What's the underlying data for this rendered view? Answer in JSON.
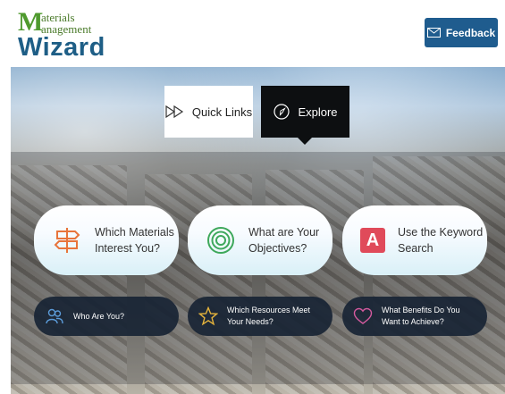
{
  "logo": {
    "m": "M",
    "line1": "aterials",
    "line2": "anagement",
    "wizard": "Wizard"
  },
  "feedback_label": "Feedback",
  "toggles": {
    "quick_links": "Quick Links",
    "explore": "Explore"
  },
  "cards": [
    {
      "label": "Which Materials\nInterest You?",
      "icon": "signpost-icon"
    },
    {
      "label": "What are Your\nObjectives?",
      "icon": "target-icon"
    },
    {
      "label": "Use the Keyword\nSearch",
      "icon": "letter-a-icon",
      "icon_text": "A"
    }
  ],
  "options": [
    {
      "label": "Who Are You?",
      "icon": "people-icon"
    },
    {
      "label": "Which Resources Meet\nYour Needs?",
      "icon": "star-icon"
    },
    {
      "label": "What Benefits Do You\nWant to Achieve?",
      "icon": "heart-icon"
    }
  ],
  "colors": {
    "accent_blue": "#1f5c8e",
    "logo_green": "#4f9a2e",
    "orange": "#e8743b",
    "green": "#3ea85b",
    "red": "#e04a5a"
  }
}
